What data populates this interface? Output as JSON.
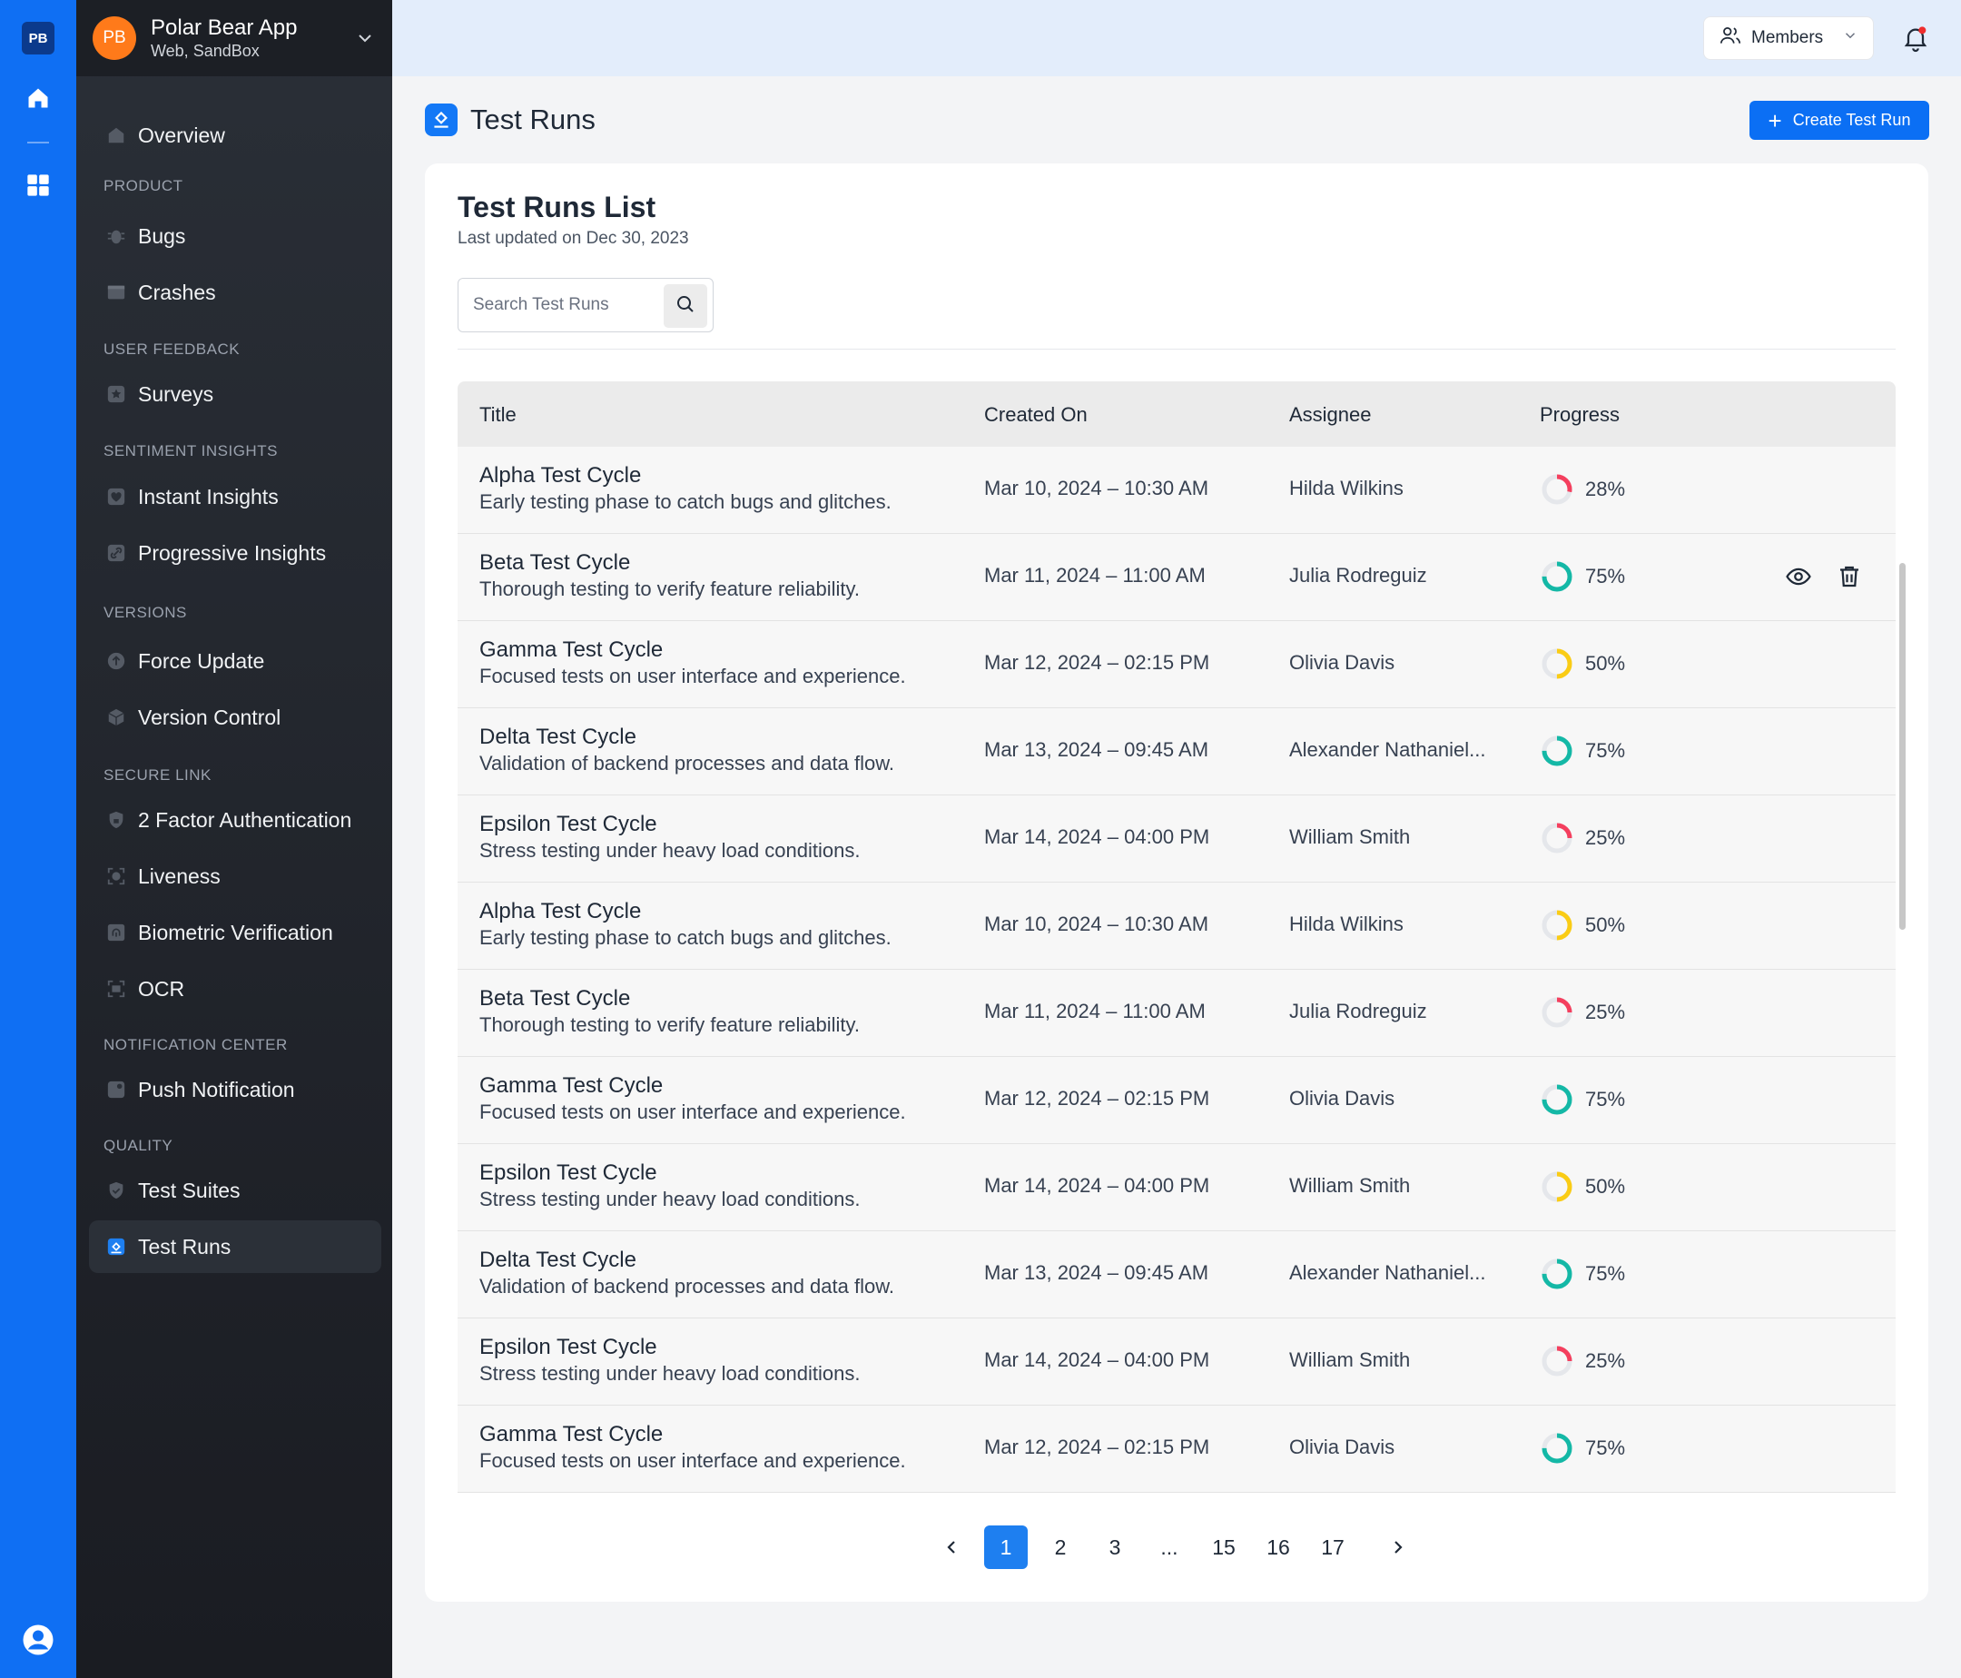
{
  "rail": {
    "logo": "PB"
  },
  "app": {
    "avatar": "PB",
    "name": "Polar Bear App",
    "env": "Web, SandBox",
    "avatar_color": "#ff7a1a"
  },
  "sidebar": {
    "overview": "Overview",
    "sections": [
      {
        "title": "PRODUCT",
        "items": [
          "Bugs",
          "Crashes"
        ]
      },
      {
        "title": "USER FEEDBACK",
        "items": [
          "Surveys"
        ]
      },
      {
        "title": "SENTIMENT INSIGHTS",
        "items": [
          "Instant Insights",
          "Progressive Insights"
        ]
      },
      {
        "title": "VERSIONS",
        "items": [
          "Force Update",
          "Version Control"
        ]
      },
      {
        "title": "SECURE LINK",
        "items": [
          "2 Factor Authentication",
          "Liveness",
          "Biometric Verification",
          "OCR"
        ]
      },
      {
        "title": "NOTIFICATION CENTER",
        "items": [
          "Push Notification"
        ]
      },
      {
        "title": "QUALITY",
        "items": [
          "Test Suites",
          "Test Runs"
        ]
      }
    ],
    "active": "Test Runs"
  },
  "topbar": {
    "members_label": "Members"
  },
  "page": {
    "title": "Test Runs",
    "create_label": "Create Test Run"
  },
  "card": {
    "title": "Test Runs List",
    "subtitle": "Last updated on Dec 30, 2023",
    "search_placeholder": "Search Test Runs"
  },
  "table": {
    "columns": [
      "Title",
      "Created On",
      "Assignee",
      "Progress"
    ],
    "rows": [
      {
        "title": "Alpha Test Cycle",
        "desc": "Early testing phase to catch bugs and glitches.",
        "created": "Mar 10, 2024 – 10:30 AM",
        "assignee": "Hilda Wilkins",
        "progress": 28,
        "progress_label": "28%"
      },
      {
        "title": "Beta Test Cycle",
        "desc": "Thorough testing to verify feature reliability.",
        "created": "Mar 11, 2024 – 11:00 AM",
        "assignee": "Julia Rodreguiz",
        "progress": 75,
        "progress_label": "75%",
        "hover": true
      },
      {
        "title": "Gamma Test Cycle",
        "desc": "Focused tests on user interface and experience.",
        "created": "Mar 12, 2024 – 02:15 PM",
        "assignee": "Olivia Davis",
        "progress": 50,
        "progress_label": "50%"
      },
      {
        "title": "Delta Test Cycle",
        "desc": "Validation of backend processes and data flow.",
        "created": "Mar 13, 2024 – 09:45 AM",
        "assignee": "Alexander Nathaniel...",
        "progress": 75,
        "progress_label": "75%"
      },
      {
        "title": "Epsilon Test Cycle",
        "desc": "Stress testing under heavy load conditions.",
        "created": "Mar 14, 2024 – 04:00 PM",
        "assignee": "William Smith",
        "progress": 25,
        "progress_label": "25%"
      },
      {
        "title": "Alpha Test Cycle",
        "desc": "Early testing phase to catch bugs and glitches.",
        "created": "Mar 10, 2024 – 10:30 AM",
        "assignee": "Hilda Wilkins",
        "progress": 50,
        "progress_label": "50%"
      },
      {
        "title": "Beta Test Cycle",
        "desc": "Thorough testing to verify feature reliability.",
        "created": "Mar 11, 2024 – 11:00 AM",
        "assignee": "Julia Rodreguiz",
        "progress": 25,
        "progress_label": "25%"
      },
      {
        "title": "Gamma Test Cycle",
        "desc": "Focused tests on user interface and experience.",
        "created": "Mar 12, 2024 – 02:15 PM",
        "assignee": "Olivia Davis",
        "progress": 75,
        "progress_label": "75%"
      },
      {
        "title": "Epsilon Test Cycle",
        "desc": "Stress testing under heavy load conditions.",
        "created": "Mar 14, 2024 – 04:00 PM",
        "assignee": "William Smith",
        "progress": 50,
        "progress_label": "50%"
      },
      {
        "title": "Delta Test Cycle",
        "desc": "Validation of backend processes and data flow.",
        "created": "Mar 13, 2024 – 09:45 AM",
        "assignee": "Alexander Nathaniel...",
        "progress": 75,
        "progress_label": "75%"
      },
      {
        "title": "Epsilon Test Cycle",
        "desc": "Stress testing under heavy load conditions.",
        "created": "Mar 14, 2024 – 04:00 PM",
        "assignee": "William Smith",
        "progress": 25,
        "progress_label": "25%"
      },
      {
        "title": "Gamma Test Cycle",
        "desc": "Focused tests on user interface and experience.",
        "created": "Mar 12, 2024 – 02:15 PM",
        "assignee": "Olivia Davis",
        "progress": 75,
        "progress_label": "75%"
      }
    ]
  },
  "progress_colors": {
    "low": "#f43f5e",
    "mid": "#facc15",
    "high": "#14b8a6",
    "track": "#e5e7eb"
  },
  "pagination": {
    "pages": [
      "1",
      "2",
      "3",
      "...",
      "15",
      "16",
      "17"
    ],
    "current": "1"
  },
  "colors": {
    "primary": "#0b6ff4",
    "rail": "#0f6ff3"
  }
}
